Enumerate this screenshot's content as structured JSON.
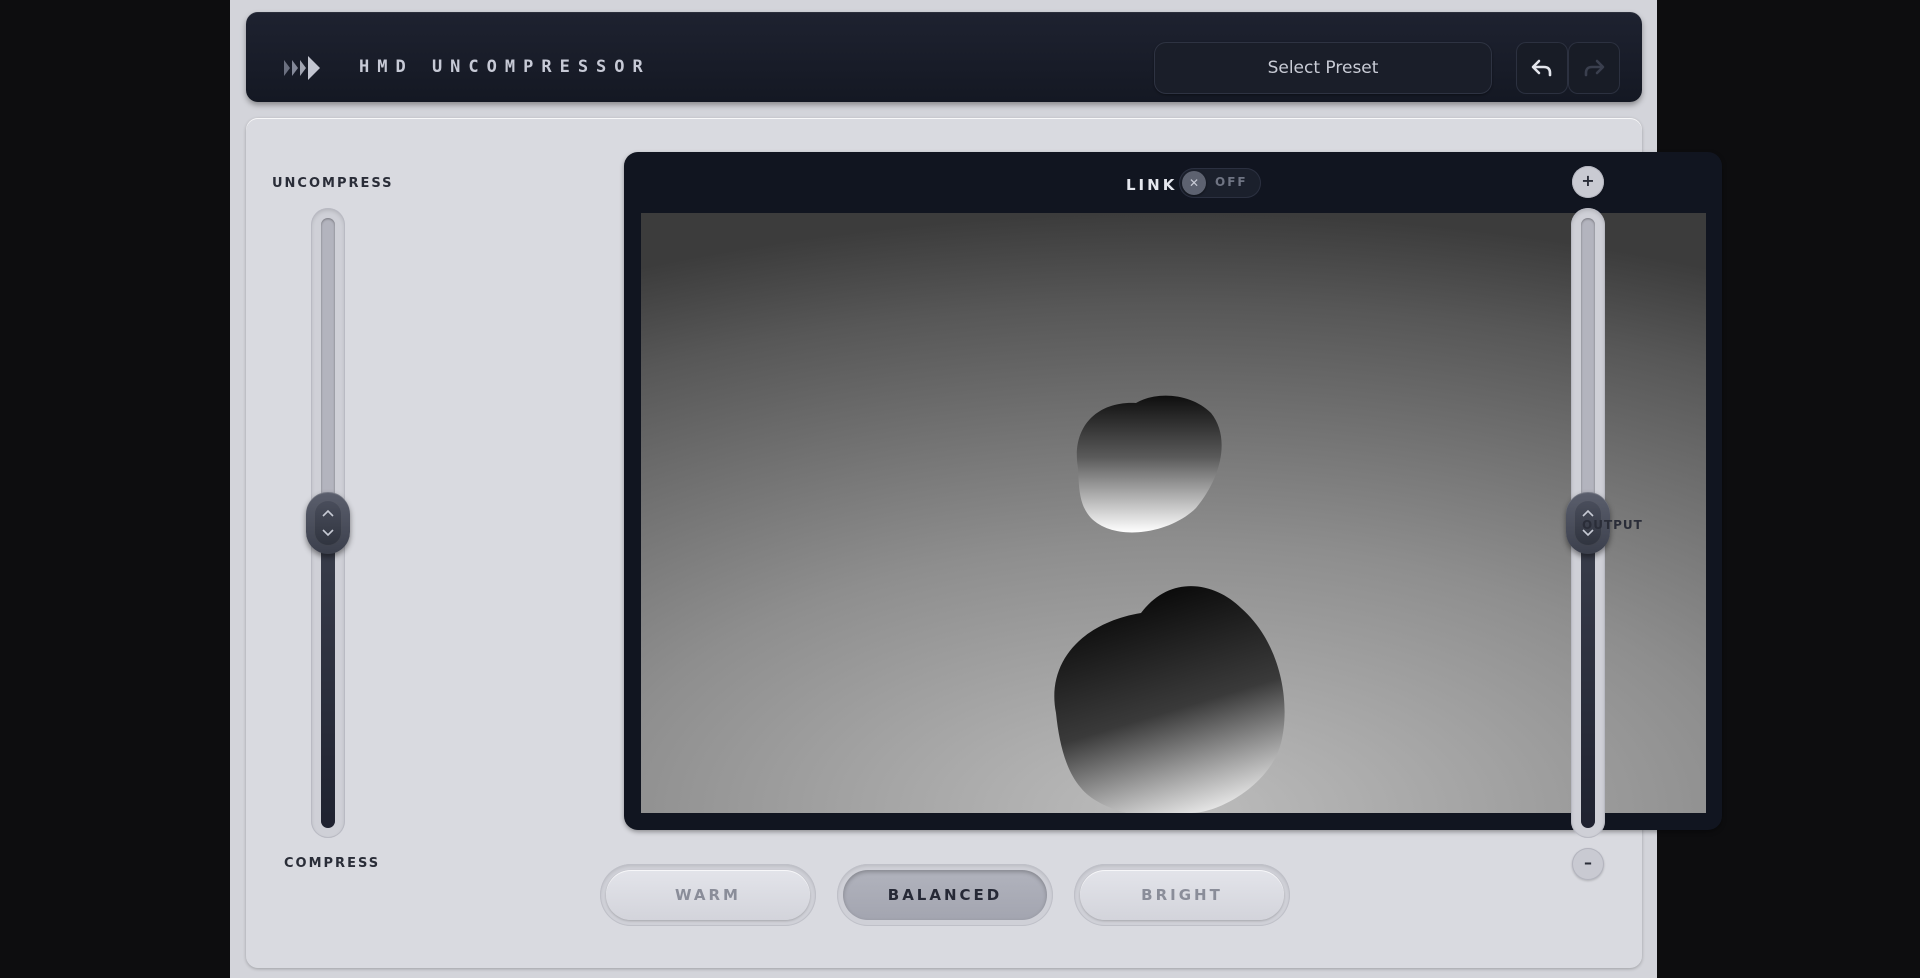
{
  "header": {
    "brand": "HMD UNCOMPRESSOR",
    "logo_icon": "play-arrows-icon",
    "preset_label": "Select Preset",
    "undo_icon": "undo-icon",
    "redo_icon": "redo-icon"
  },
  "left_slider": {
    "top_label": "UNCOMPRESS",
    "bottom_label": "COMPRESS",
    "level": 0.5
  },
  "right_slider": {
    "label": "OUTPUT",
    "plus": "+",
    "minus": "–",
    "level": 0.5
  },
  "display": {
    "link_label": "LINK",
    "link_state": "OFF",
    "link_knob": "✕"
  },
  "tones": {
    "warm": "WARM",
    "balanced": "BALANCED",
    "bright": "BRIGHT",
    "selected": "BALANCED"
  }
}
